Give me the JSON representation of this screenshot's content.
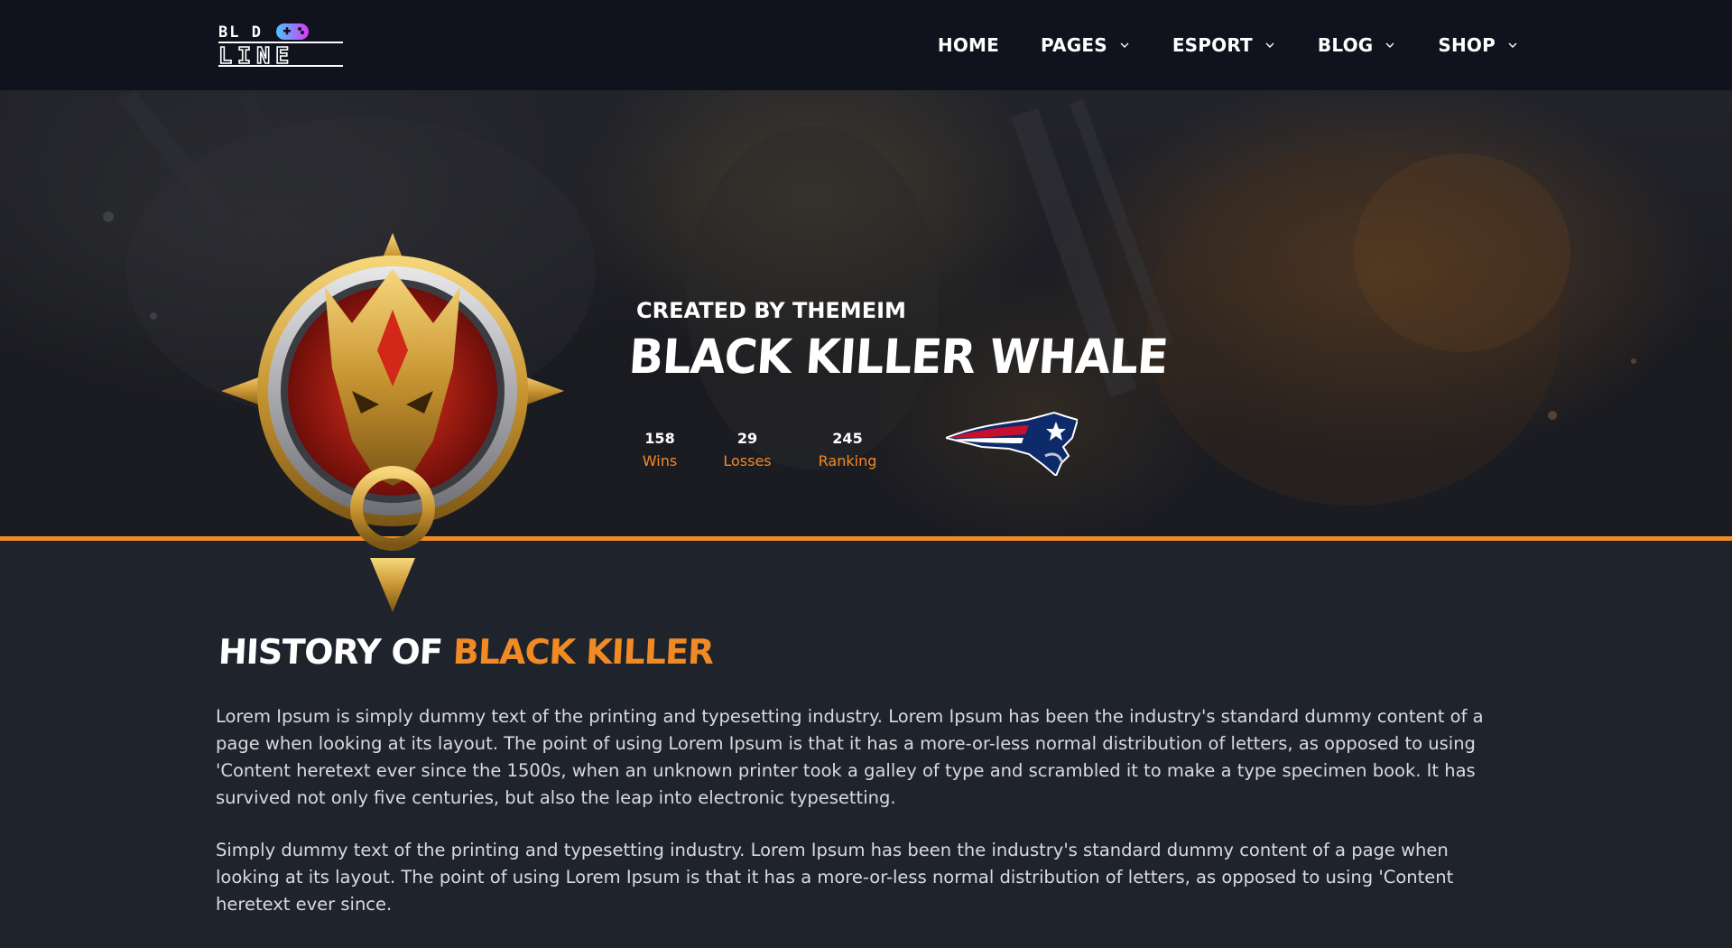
{
  "brand": {
    "logo_top_text": "BL  D",
    "logo_bottom_text": "LINE"
  },
  "nav": {
    "items": [
      {
        "label": "HOME",
        "has_dropdown": false
      },
      {
        "label": "PAGES",
        "has_dropdown": true
      },
      {
        "label": "ESPORT",
        "has_dropdown": true
      },
      {
        "label": "BLOG",
        "has_dropdown": true
      },
      {
        "label": "SHOP",
        "has_dropdown": true
      }
    ]
  },
  "hero": {
    "created_by": "CREATED BY THEMEIM",
    "team_name": "BLACK KILLER WHALE",
    "stats": [
      {
        "value": "158",
        "label": "Wins"
      },
      {
        "value": "29",
        "label": "Losses"
      },
      {
        "value": "245",
        "label": "Ranking"
      }
    ],
    "badge_icon": "golden-dragon-badge-icon",
    "team_logo_icon": "patriot-head-logo-icon"
  },
  "history": {
    "title_white": "HISTORY OF ",
    "title_accent": "BLACK KILLER",
    "paragraphs": [
      "Lorem Ipsum is simply dummy text of the printing and typesetting industry. Lorem Ipsum has been the industry's standard dummy content of a page when looking at its layout. The point of using Lorem Ipsum is that it has a more-or-less normal distribution of letters, as opposed to using 'Content heretext ever since the 1500s, when an unknown printer took a galley of type and scrambled it to make a type specimen book. It has survived not only five centuries, but also the leap into electronic typesetting.",
      "Simply dummy text of the printing and typesetting industry. Lorem Ipsum has been the industry's standard dummy content of a page when looking at its layout. The point of using Lorem Ipsum is that it has a more-or-less normal distribution of letters, as opposed to using 'Content heretext ever since."
    ]
  },
  "colors": {
    "accent": "#f08a24",
    "header_bg": "#10121d",
    "page_bg": "#1f232c"
  }
}
